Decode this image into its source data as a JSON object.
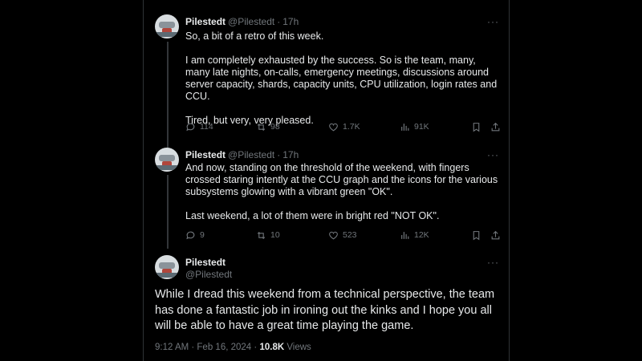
{
  "tweets": [
    {
      "name": "Pilestedt",
      "handle": "@Pilestedt",
      "time": "17h",
      "more": "···",
      "body": "So, a bit of a retro of this week.\n\nI am completely exhausted by the success. So is the team, many, many late nights, on-calls, emergency meetings, discussions around server capacity, shards, capacity units, CPU utilization, login rates and CCU.\n\nTired, but very, very pleased.",
      "replies": "114",
      "reposts": "98",
      "likes": "1.7K",
      "views": "91K"
    },
    {
      "name": "Pilestedt",
      "handle": "@Pilestedt",
      "time": "17h",
      "more": "···",
      "body": "And now, standing on the threshold of the weekend, with fingers crossed staring intently at the CCU graph and the icons for the various subsystems glowing with a vibrant green \"OK\".\n\nLast weekend, a lot of them were in bright red \"NOT OK\".",
      "replies": "9",
      "reposts": "10",
      "likes": "523",
      "views": "12K"
    }
  ],
  "main_tweet": {
    "name": "Pilestedt",
    "handle": "@Pilestedt",
    "more": "···",
    "body": "While I dread this weekend from a technical perspective, the team has done a fantastic job in ironing out the kinks and I hope you all will be able to have a great time playing the game.",
    "timestamp": "9:12 AM · Feb 16, 2024",
    "separator": "·",
    "view_count": "10.8K",
    "views_label": "Views"
  },
  "icons": {
    "reply": "reply-icon",
    "repost": "repost-icon",
    "like": "heart-icon",
    "views": "views-chart-icon",
    "bookmark": "bookmark-icon",
    "share": "share-icon",
    "more": "more-icon"
  }
}
